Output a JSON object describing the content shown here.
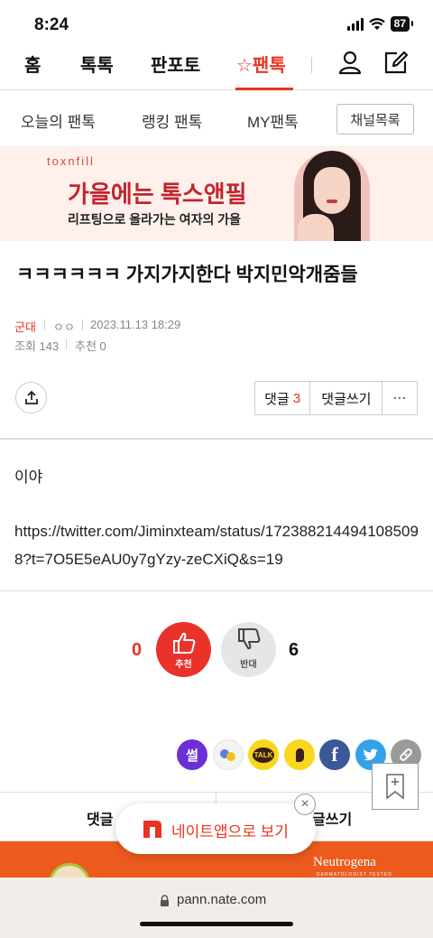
{
  "status_bar": {
    "time": "8:24",
    "battery": "87"
  },
  "top_nav": {
    "tabs": [
      "홈",
      "톡톡",
      "판포토",
      "☆팬톡"
    ]
  },
  "sub_nav": {
    "items": [
      "오늘의 팬톡",
      "랭킹 팬톡",
      "MY팬톡"
    ],
    "channel_list": "채널목록"
  },
  "ad": {
    "brand": "toxnfill",
    "headline": "가을에는 톡스앤필",
    "subtext": "리프팅으로 올라가는 여자의 가을"
  },
  "post": {
    "title": "ㅋㅋㅋㅋㅋㅋ 가지가지한다 박지민악개줌들",
    "author": "군대",
    "author_sub": "ㅇㅇ",
    "date": "2023.11.13 18:29",
    "views": "조회 143",
    "recommends": "추천 0",
    "body_line1": "이야",
    "body_url": "https://twitter.com/Jiminxteam/status/1723882144941085098?t=7O5E5eAU0y7gYzy-zeCXiQ&s=19"
  },
  "actions": {
    "comment_label": "댓글",
    "comment_count": "3",
    "write_comment": "댓글쓰기",
    "more": "···"
  },
  "votes": {
    "up_count": "0",
    "up_label": "추천",
    "down_label": "반대",
    "down_count": "6"
  },
  "share": {
    "ssul": "썰",
    "talk": "TALK"
  },
  "bottom_tabs": {
    "comments": "댓글",
    "write": "글쓰기"
  },
  "bottom_ad": {
    "brand": "Neutrogena",
    "tagline": "DERMATOLOGIST TESTED"
  },
  "app_banner": {
    "text": "네이트앱으로 보기"
  },
  "url_bar": {
    "url": "pann.nate.com"
  },
  "colors": {
    "accent": "#e8331f",
    "recommend": "#e9332a",
    "oppose": "#e6e6e6"
  }
}
